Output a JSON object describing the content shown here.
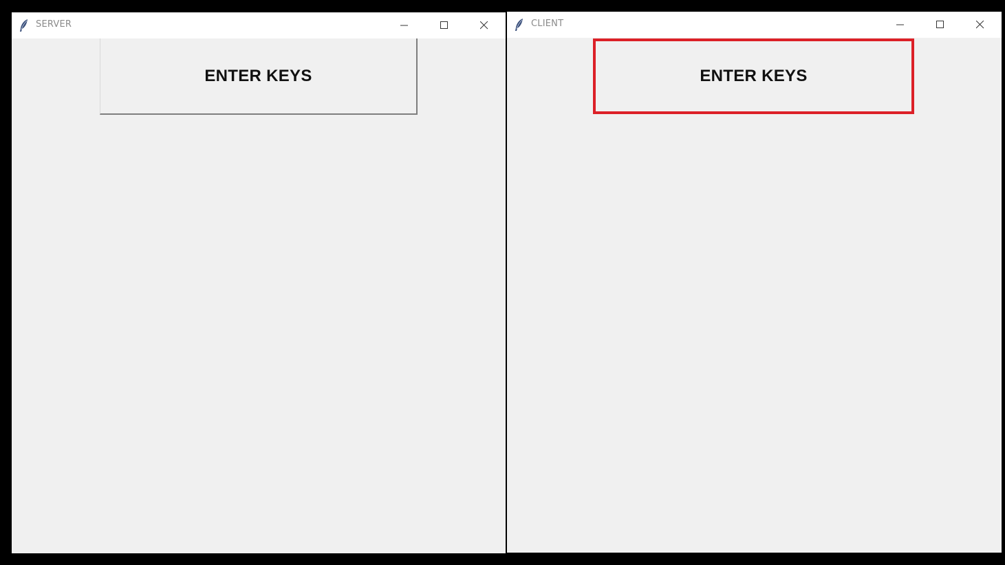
{
  "server_window": {
    "title": "SERVER",
    "app_icon": "tk-feather-icon",
    "controls": [
      "minimize-icon",
      "maximize-icon",
      "close-icon"
    ],
    "button_label": "ENTER KEYS"
  },
  "client_window": {
    "title": "CLIENT",
    "app_icon": "tk-feather-icon",
    "controls": [
      "minimize-icon",
      "maximize-icon",
      "close-icon"
    ],
    "button_label": "ENTER KEYS",
    "highlight_color": "#dc2027"
  },
  "colors": {
    "desktop": "#000000",
    "window_bg": "#f0f0f0",
    "titlebar_bg": "#ffffff",
    "title_text": "#8a8a8a"
  }
}
